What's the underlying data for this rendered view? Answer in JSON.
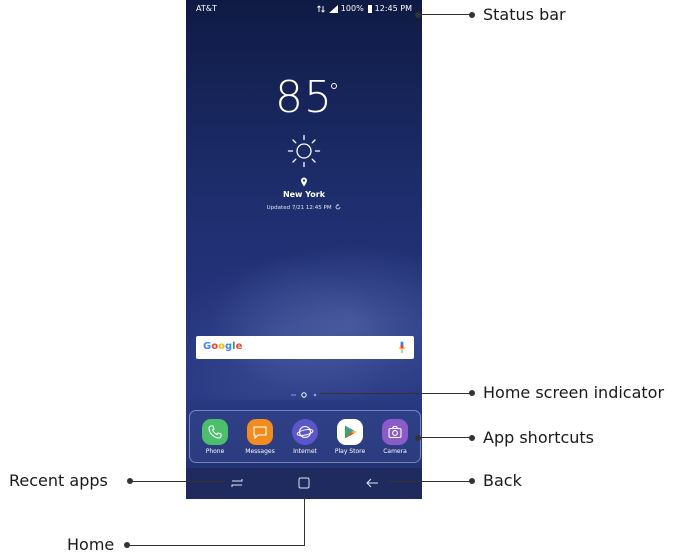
{
  "status_bar": {
    "carrier": "AT&T",
    "battery": "100%",
    "time": "12:45 PM"
  },
  "weather": {
    "temperature": "85",
    "degree_symbol": "°",
    "condition_icon": "sun-icon",
    "city": "New York",
    "updated": "Updated 7/21 12:45 PM"
  },
  "search": {
    "brand": "Google",
    "mic_icon": "mic-icon"
  },
  "home_pages": {
    "count": 3,
    "current": 2
  },
  "dock": {
    "apps": [
      {
        "label": "Phone",
        "icon": "phone-icon",
        "color": "#4bbf6b"
      },
      {
        "label": "Messages",
        "icon": "message-icon",
        "color": "#f28c1f"
      },
      {
        "label": "Internet",
        "icon": "internet-icon",
        "color": "#5b57c9"
      },
      {
        "label": "Play Store",
        "icon": "play-store-icon",
        "color": "#ffffff"
      },
      {
        "label": "Camera",
        "icon": "camera-icon",
        "color": "#8a5cc8"
      }
    ]
  },
  "nav_bar": {
    "recent_icon": "recent-apps-icon",
    "home_icon": "home-icon",
    "back_icon": "back-icon"
  },
  "callouts": {
    "status_bar": "Status bar",
    "home_indicator": "Home screen indicator",
    "app_shortcuts": "App shortcuts",
    "back": "Back",
    "recent_apps": "Recent apps",
    "home": "Home"
  }
}
